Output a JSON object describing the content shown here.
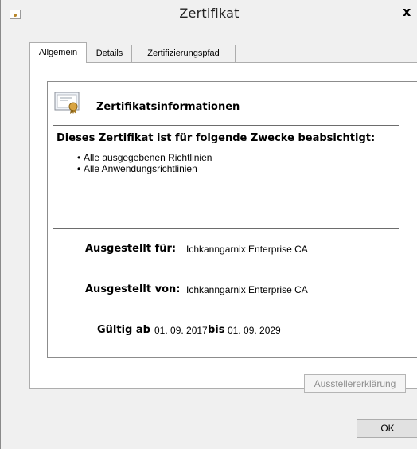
{
  "window": {
    "title": "Zertifikat",
    "close_glyph": "x"
  },
  "tabs": [
    {
      "label": "Allgemein",
      "active": true
    },
    {
      "label": "Details",
      "active": false
    },
    {
      "label": "Zertifizierungspfad",
      "active": false
    }
  ],
  "certificate": {
    "icon": "certificate-icon",
    "heading": "Zertifikatsinformationen",
    "purpose_title": "Dieses Zertifikat ist für folgende Zwecke beabsichtigt:",
    "purposes": [
      "Alle ausgegebenen Richtlinien",
      "Alle Anwendungsrichtlinien"
    ],
    "issued_to_label": "Ausgestellt für:",
    "issued_to_value": "Ichkanngarnix Enterprise CA",
    "issued_by_label": "Ausgestellt von:",
    "issued_by_value": "Ichkanngarnix Enterprise CA",
    "valid_from_label": "Gültig ab",
    "valid_from_value": "01. 09. 2017",
    "valid_to_label": "bis",
    "valid_to_value": "01. 09. 2029"
  },
  "buttons": {
    "issuer_statement": "Ausstellererklärung",
    "ok": "OK"
  },
  "colors": {
    "window_bg": "#f0f0f0",
    "panel_bg": "#ffffff",
    "border": "#adadad",
    "disabled_text": "#8d8d8d"
  }
}
